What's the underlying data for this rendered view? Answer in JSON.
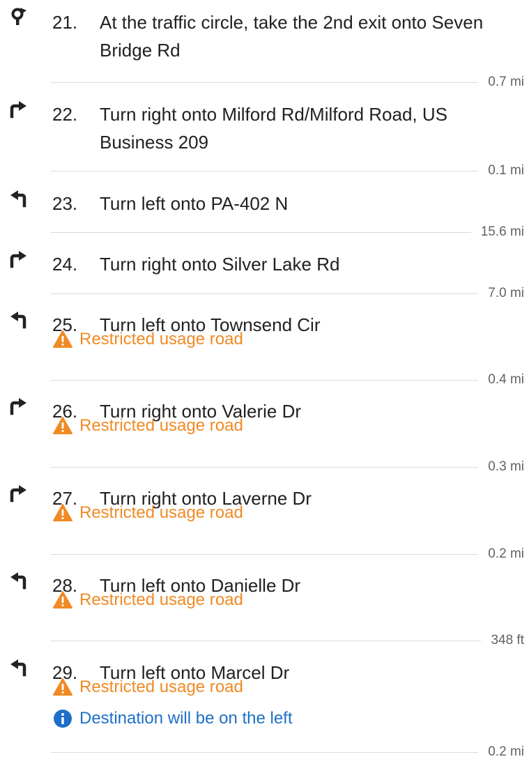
{
  "colors": {
    "text": "#212121",
    "warning": "#f08a24",
    "info": "#1e6fc8",
    "divider": "#dadada",
    "distance": "#5f6368"
  },
  "steps": [
    {
      "number": "21.",
      "icon": "traffic-circle-icon",
      "instruction": "At the traffic circle, take the 2nd exit onto Seven Bridge Rd",
      "notices": [],
      "distance": "0.7 mi"
    },
    {
      "number": "22.",
      "icon": "turn-right-icon",
      "instruction": "Turn right onto Milford Rd/Milford Road, US Business 209",
      "notices": [],
      "distance": "0.1 mi"
    },
    {
      "number": "23.",
      "icon": "turn-left-icon",
      "instruction": "Turn left onto PA-402 N",
      "notices": [],
      "distance": "15.6 mi"
    },
    {
      "number": "24.",
      "icon": "turn-right-icon",
      "instruction": "Turn right onto Silver Lake Rd",
      "notices": [],
      "distance": "7.0 mi"
    },
    {
      "number": "25.",
      "icon": "turn-left-icon",
      "instruction": "Turn left onto Townsend Cir",
      "notices": [
        {
          "type": "warning",
          "icon": "warning-icon",
          "text": "Restricted usage road"
        }
      ],
      "distance": "0.4 mi"
    },
    {
      "number": "26.",
      "icon": "turn-right-icon",
      "instruction": "Turn right onto Valerie Dr",
      "notices": [
        {
          "type": "warning",
          "icon": "warning-icon",
          "text": "Restricted usage road"
        }
      ],
      "distance": "0.3 mi"
    },
    {
      "number": "27.",
      "icon": "turn-right-icon",
      "instruction": "Turn right onto Laverne Dr",
      "notices": [
        {
          "type": "warning",
          "icon": "warning-icon",
          "text": "Restricted usage road"
        }
      ],
      "distance": "0.2 mi"
    },
    {
      "number": "28.",
      "icon": "turn-left-icon",
      "instruction": "Turn left onto Danielle Dr",
      "notices": [
        {
          "type": "warning",
          "icon": "warning-icon",
          "text": "Restricted usage road"
        }
      ],
      "distance": "348 ft"
    },
    {
      "number": "29.",
      "icon": "turn-left-icon",
      "instruction": "Turn left onto Marcel Dr",
      "notices": [
        {
          "type": "warning",
          "icon": "warning-icon",
          "text": "Restricted usage road"
        },
        {
          "type": "info",
          "icon": "info-icon",
          "text": "Destination will be on the left"
        }
      ],
      "distance": "0.2 mi"
    }
  ]
}
